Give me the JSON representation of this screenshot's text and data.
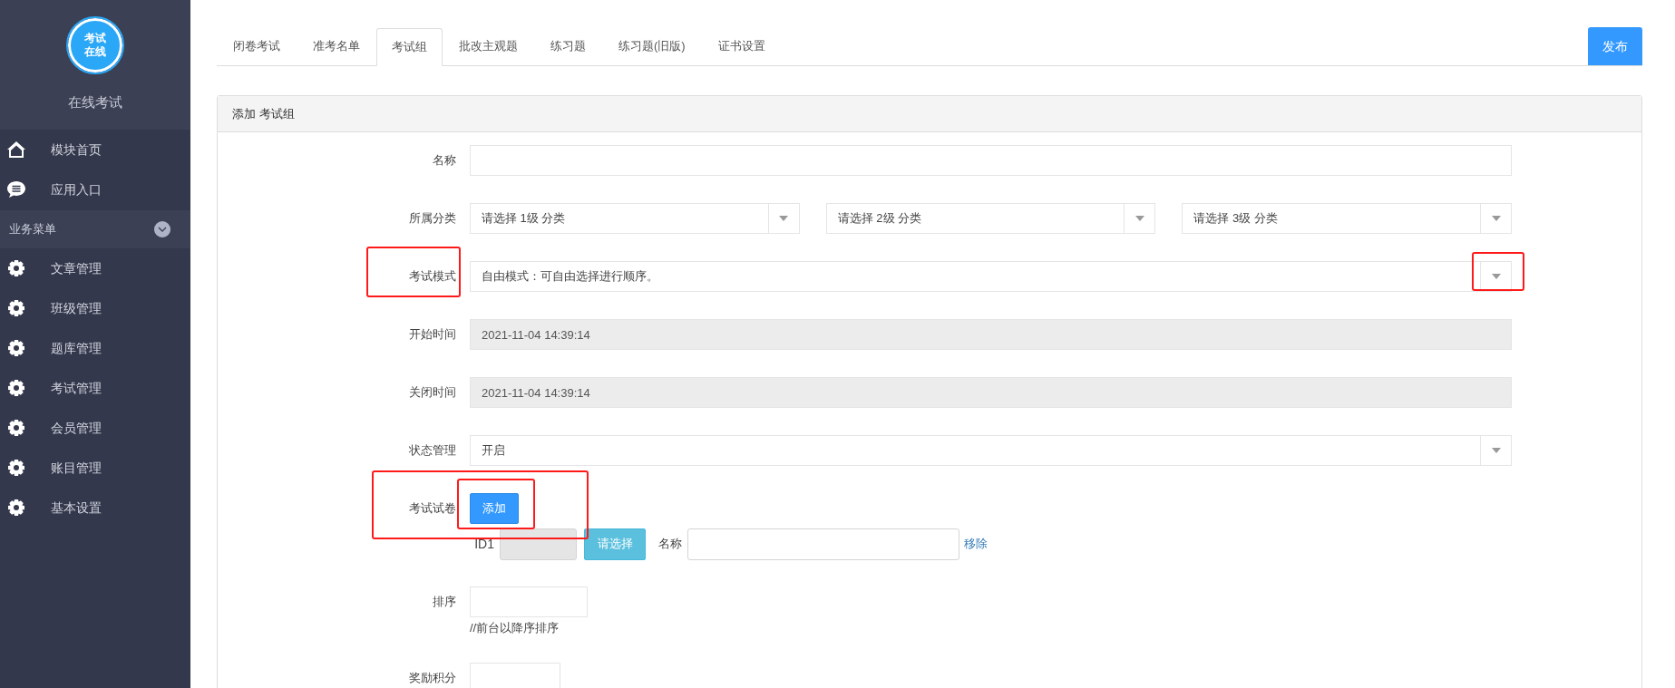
{
  "sidebar": {
    "logo_lines": [
      "考试",
      "在线"
    ],
    "title": "在线考试",
    "top_items": [
      {
        "kind": "home",
        "label": "模块首页"
      },
      {
        "kind": "chat",
        "label": "应用入口"
      }
    ],
    "section": {
      "label": "业务菜单"
    },
    "menu_items": [
      {
        "label": "文章管理"
      },
      {
        "label": "班级管理"
      },
      {
        "label": "题库管理"
      },
      {
        "label": "考试管理"
      },
      {
        "label": "会员管理"
      },
      {
        "label": "账目管理"
      },
      {
        "label": "基本设置"
      }
    ]
  },
  "tabs": [
    {
      "label": "闭卷考试",
      "selected": false
    },
    {
      "label": "准考名单",
      "selected": false
    },
    {
      "label": "考试组",
      "selected": true
    },
    {
      "label": "批改主观题",
      "selected": false
    },
    {
      "label": "练习题",
      "selected": false
    },
    {
      "label": "练习题(旧版)",
      "selected": false
    },
    {
      "label": "证书设置",
      "selected": false
    }
  ],
  "publish_button": "发布",
  "panel": {
    "title": "添加 考试组",
    "fields": [
      {
        "kind": "text",
        "label": "名称"
      },
      {
        "kind": "selects",
        "label": "所属分类",
        "options": [
          "请选择 1级 分类",
          "请选择 2级 分类",
          "请选择 3级 分类"
        ]
      },
      {
        "kind": "select",
        "label": "考试模式",
        "value": "自由模式：可自由选择进行顺序。"
      },
      {
        "kind": "readonly",
        "label": "开始时间",
        "value": "2021-11-04 14:39:14"
      },
      {
        "kind": "readonly",
        "label": "关闭时间",
        "value": "2021-11-04 14:39:14"
      },
      {
        "kind": "select",
        "label": "状态管理",
        "value": "开启"
      },
      {
        "kind": "paper",
        "label": "考试试卷",
        "add_button": "添加",
        "items": [
          {
            "id_label": "ID1",
            "choose_button": "请选择",
            "name_label": "名称",
            "remove_link": "移除"
          }
        ]
      },
      {
        "kind": "number",
        "label": "排序",
        "hint": "//前台以降序排序"
      },
      {
        "kind": "short",
        "label": "奖励积分"
      }
    ]
  }
}
